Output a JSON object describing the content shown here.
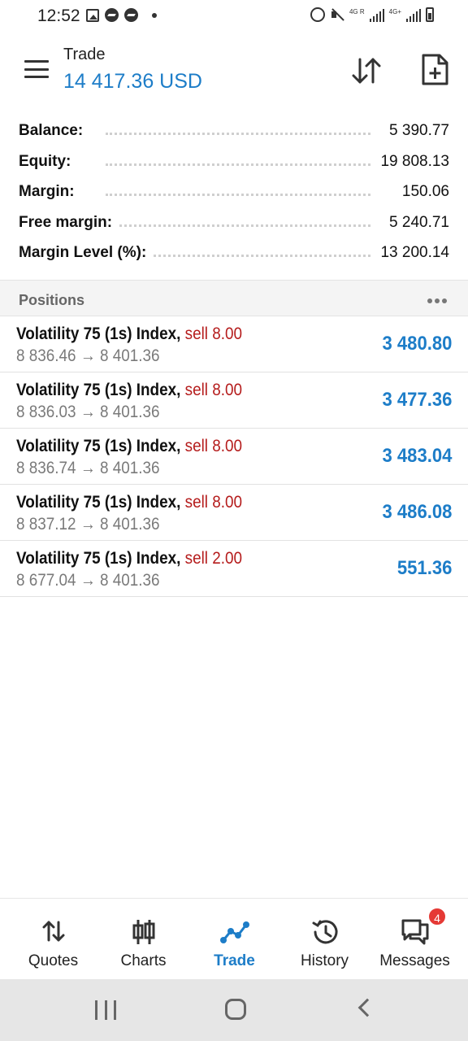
{
  "status_bar": {
    "time": "12:52",
    "left_icons": [
      "gallery-icon",
      "messenger-icon",
      "messenger-icon",
      "dot-icon"
    ],
    "right_icons": [
      "alarm-icon",
      "mute-icon",
      "signal-icon",
      "signal-icon",
      "battery-icon"
    ],
    "sim1_tag": "4G R",
    "sim2_tag": "4G+"
  },
  "header": {
    "title": "Trade",
    "balance": "14 417.36 USD",
    "accent_color": "#1d7dc8"
  },
  "summary": [
    {
      "label": "Balance:",
      "value": "5 390.77"
    },
    {
      "label": "Equity:",
      "value": "19 808.13"
    },
    {
      "label": "Margin:",
      "value": "150.06"
    },
    {
      "label": "Free margin:",
      "value": "5 240.71"
    },
    {
      "label": "Margin Level (%):",
      "value": "13 200.14"
    }
  ],
  "positions": {
    "title": "Positions",
    "items": [
      {
        "symbol": "Volatility 75 (1s) Index,",
        "side": "sell 8.00",
        "prices": "8 836.46 → 8 401.36",
        "profit": "3 480.80"
      },
      {
        "symbol": "Volatility 75 (1s) Index,",
        "side": "sell 8.00",
        "prices": "8 836.03 → 8 401.36",
        "profit": "3 477.36"
      },
      {
        "symbol": "Volatility 75 (1s) Index,",
        "side": "sell 8.00",
        "prices": "8 836.74 → 8 401.36",
        "profit": "3 483.04"
      },
      {
        "symbol": "Volatility 75 (1s) Index,",
        "side": "sell 8.00",
        "prices": "8 837.12 → 8 401.36",
        "profit": "3 486.08"
      },
      {
        "symbol": "Volatility 75 (1s) Index,",
        "side": "sell 2.00",
        "prices": "8 677.04 → 8 401.36",
        "profit": "551.36"
      }
    ]
  },
  "bottom_nav": {
    "items": [
      {
        "label": "Quotes",
        "icon": "quotes-icon"
      },
      {
        "label": "Charts",
        "icon": "charts-icon"
      },
      {
        "label": "Trade",
        "icon": "trade-icon",
        "active": true
      },
      {
        "label": "History",
        "icon": "history-icon"
      },
      {
        "label": "Messages",
        "icon": "messages-icon",
        "badge": "4"
      }
    ]
  }
}
